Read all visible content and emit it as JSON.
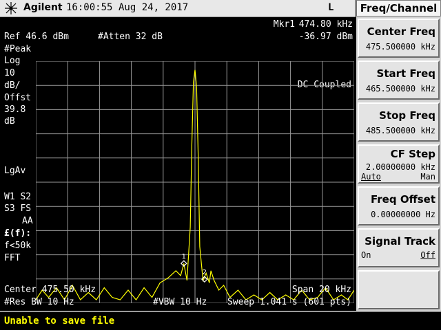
{
  "topbar": {
    "brand": "Agilent",
    "time": "16:00:55",
    "date": "Aug 24, 2017",
    "indicator": "L"
  },
  "marker": {
    "label": "Mkr1",
    "frequency": "474.80 kHz",
    "amplitude": "-36.97 dBm"
  },
  "settings": {
    "ref_level": "Ref 46.6 dBm",
    "atten": "#Atten 32 dB",
    "detector": "#Peak",
    "scale": [
      "Log",
      "10",
      "dB/"
    ],
    "offset": [
      "Offst",
      "39.8",
      "dB"
    ],
    "avg": "LgAv",
    "trace_w1": "W1  S2",
    "trace_s3": "S3  FS",
    "trace_aa": "AA",
    "freq_corr": "£(f):",
    "f_lt": "f<50k",
    "fft": "FFT",
    "dc_coupled": "DC Coupled",
    "center": "Center 475.50 kHz",
    "span": "Span 20 kHz",
    "res_bw": "#Res BW 10 Hz",
    "vbw": "#VBW 10 Hz",
    "sweep": "Sweep 1.041 s (601 pts)"
  },
  "chart_data": {
    "type": "line",
    "x_label": "",
    "y_label": "",
    "x_range_khz": [
      465.5,
      485.5
    ],
    "y_range_dbm": [
      -53.4,
      46.6
    ],
    "y_div_db": 10,
    "grid": true,
    "trace_color": "#ffff00",
    "series": [
      {
        "name": "",
        "points_khz_dbm": [
          [
            465.5,
            -52
          ],
          [
            465.9,
            -48
          ],
          [
            466.3,
            -51
          ],
          [
            466.8,
            -47
          ],
          [
            467.3,
            -52
          ],
          [
            467.8,
            -46
          ],
          [
            468.3,
            -52
          ],
          [
            468.8,
            -49
          ],
          [
            469.3,
            -52
          ],
          [
            469.8,
            -47
          ],
          [
            470.3,
            -51
          ],
          [
            470.8,
            -52
          ],
          [
            471.3,
            -48
          ],
          [
            471.8,
            -52
          ],
          [
            472.3,
            -47
          ],
          [
            472.8,
            -51
          ],
          [
            473.3,
            -45
          ],
          [
            473.8,
            -43
          ],
          [
            474.3,
            -40
          ],
          [
            474.6,
            -42
          ],
          [
            474.8,
            -37
          ],
          [
            475.0,
            -44
          ],
          [
            475.2,
            -22
          ],
          [
            475.3,
            12
          ],
          [
            475.4,
            38
          ],
          [
            475.5,
            43
          ],
          [
            475.6,
            36
          ],
          [
            475.7,
            8
          ],
          [
            475.8,
            -30
          ],
          [
            476.0,
            -44
          ],
          [
            476.2,
            -41
          ],
          [
            476.4,
            -45
          ],
          [
            476.5,
            -40
          ],
          [
            476.7,
            -44
          ],
          [
            477.0,
            -48
          ],
          [
            477.3,
            -46
          ],
          [
            477.7,
            -51
          ],
          [
            478.2,
            -48
          ],
          [
            478.7,
            -52
          ],
          [
            479.2,
            -50
          ],
          [
            479.7,
            -52
          ],
          [
            480.2,
            -49
          ],
          [
            480.7,
            -52
          ],
          [
            481.2,
            -50
          ],
          [
            481.7,
            -52
          ],
          [
            482.2,
            -48
          ],
          [
            482.7,
            -52
          ],
          [
            483.2,
            -51
          ],
          [
            483.7,
            -47
          ],
          [
            484.2,
            -52
          ],
          [
            484.7,
            -50
          ],
          [
            485.1,
            -52
          ],
          [
            485.5,
            -48
          ]
        ]
      }
    ],
    "markers": [
      {
        "id": "1",
        "x_khz": 474.8,
        "y_dbm": -36.97
      },
      {
        "id": "2",
        "x_khz": 476.1,
        "y_dbm": -43.5
      }
    ]
  },
  "softkeys": {
    "title": "Freq/Channel",
    "center_freq": {
      "label": "Center Freq",
      "value": "475.500000 kHz"
    },
    "start_freq": {
      "label": "Start Freq",
      "value": "465.500000 kHz"
    },
    "stop_freq": {
      "label": "Stop Freq",
      "value": "485.500000 kHz"
    },
    "cf_step": {
      "label": "CF Step",
      "value": "2.00000000 kHz",
      "opt_auto": "Auto",
      "opt_man": "Man"
    },
    "freq_offset": {
      "label": "Freq Offset",
      "value": "0.00000000  Hz"
    },
    "signal_track": {
      "label": "Signal Track",
      "opt_on": "On",
      "opt_off": "Off"
    }
  },
  "status": {
    "message": "Unable to save file"
  },
  "colors": {
    "trace": "#ffff00",
    "grid": "#9a9a9a",
    "status_text": "#ffff00"
  }
}
